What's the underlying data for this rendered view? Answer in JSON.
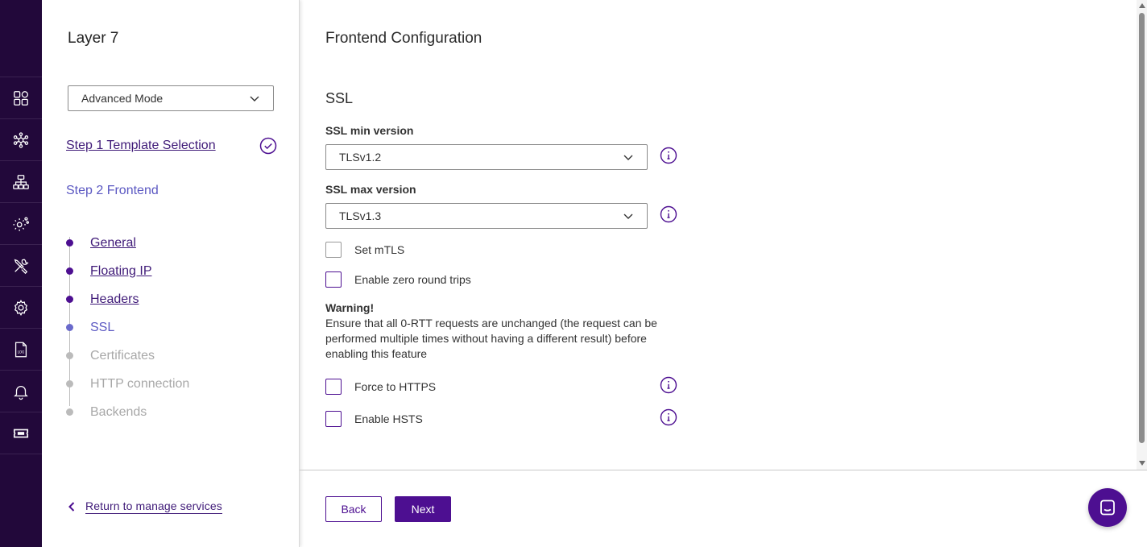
{
  "sidebar": {
    "title": "Layer 7",
    "mode_select": "Advanced Mode",
    "step1_label": "Step 1 Template Selection",
    "step2_label": "Step 2 Frontend",
    "substeps": [
      {
        "label": "General",
        "state": "done"
      },
      {
        "label": "Floating IP",
        "state": "done"
      },
      {
        "label": "Headers",
        "state": "done"
      },
      {
        "label": "SSL",
        "state": "active"
      },
      {
        "label": "Certificates",
        "state": "pending"
      },
      {
        "label": "HTTP connection",
        "state": "pending"
      },
      {
        "label": "Backends",
        "state": "pending"
      }
    ],
    "return_link": "Return to manage services"
  },
  "rail": {
    "icons": [
      "dashboard-icon",
      "services-icon",
      "network-icon",
      "settings-cluster-icon",
      "tools-icon",
      "settings-icon",
      "log-file-icon",
      "notification-bell-icon",
      "ticket-icon"
    ]
  },
  "main": {
    "page_title": "Frontend Configuration",
    "section_title": "SSL",
    "ssl_min_label": "SSL min version",
    "ssl_min_value": "TLSv1.2",
    "ssl_max_label": "SSL max version",
    "ssl_max_value": "TLSv1.3",
    "checkbox_mtls": "Set mTLS",
    "checkbox_zero_rtt": "Enable zero round trips",
    "warning_title": "Warning!",
    "warning_text": "Ensure that all 0-RTT requests are unchanged (the request can be performed multiple times without having a different result) before enabling this feature",
    "checkbox_https": "Force to HTTPS",
    "checkbox_hsts": "Enable HSTS"
  },
  "footer": {
    "back_label": "Back",
    "next_label": "Next"
  },
  "colors": {
    "rail_bg": "#22083a",
    "accent": "#4d0f91",
    "active_step": "#5b58c2",
    "pending_step": "#a8a8a8"
  }
}
